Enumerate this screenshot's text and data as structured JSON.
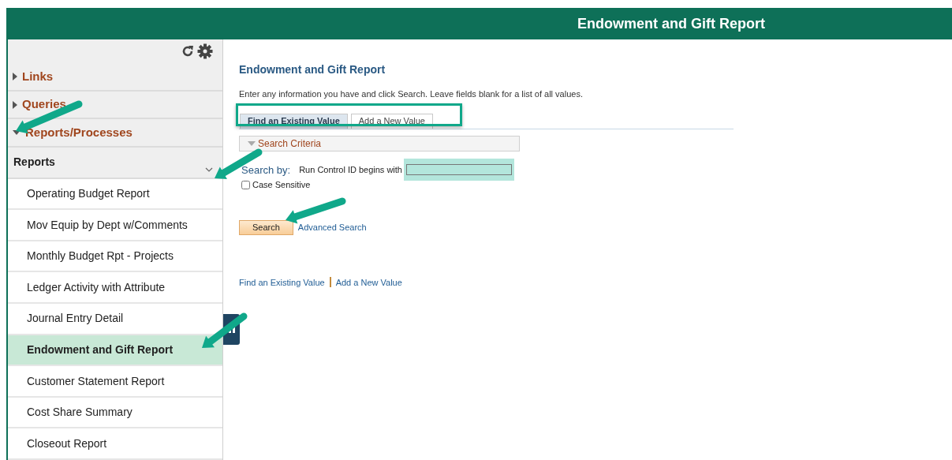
{
  "header": {
    "title": "Endowment and Gift Report"
  },
  "sidebar": {
    "sections": [
      {
        "label": "Links",
        "expanded": false
      },
      {
        "label": "Queries",
        "expanded": false
      },
      {
        "label": "Reports/Processes",
        "expanded": true
      }
    ],
    "group": {
      "label": "Reports",
      "expanded": true
    },
    "items": [
      {
        "label": "Operating Budget Report",
        "selected": false
      },
      {
        "label": "Mov Equip by Dept w/Comments",
        "selected": false
      },
      {
        "label": "Monthly Budget Rpt - Projects",
        "selected": false
      },
      {
        "label": "Ledger Activity with Attribute",
        "selected": false
      },
      {
        "label": "Journal Entry Detail",
        "selected": false
      },
      {
        "label": "Endowment and Gift Report",
        "selected": true
      },
      {
        "label": "Customer Statement Report",
        "selected": false
      },
      {
        "label": "Cost Share Summary",
        "selected": false
      },
      {
        "label": "Closeout Report",
        "selected": false
      }
    ]
  },
  "main": {
    "title": "Endowment and Gift Report",
    "instructions": "Enter any information you have and click Search. Leave fields blank for a list of all values.",
    "tabs": [
      {
        "label": "Find an Existing Value",
        "selected": true
      },
      {
        "label": "Add a New Value",
        "selected": false
      }
    ],
    "criteria": {
      "label": "Search Criteria",
      "expanded": true
    },
    "search_by": "Search by:",
    "field": {
      "label": "Run Control ID",
      "operator": "begins with"
    },
    "checkbox": {
      "label": "Case Sensitive",
      "checked": false
    },
    "search_button": "Search",
    "advanced_link": "Advanced Search",
    "footer_links": [
      "Find an Existing Value",
      "Add a New Value"
    ]
  }
}
